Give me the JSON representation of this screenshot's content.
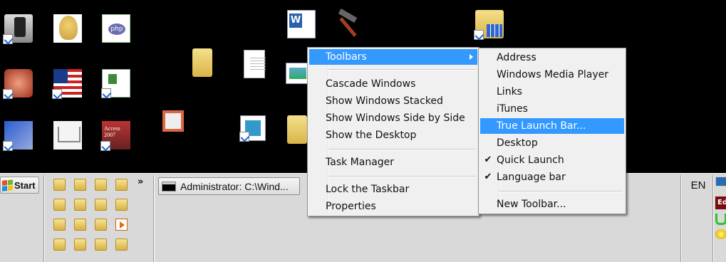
{
  "desktop": {
    "icons": [
      {
        "name": "device-sync-shortcut-icon"
      },
      {
        "name": "head-avatar-icon"
      },
      {
        "name": "php-network-icon"
      },
      {
        "name": "game-shortcut-icon"
      },
      {
        "name": "uk-flag-shortcut-icon"
      },
      {
        "name": "network-shortcut-icon"
      },
      {
        "name": "windows-update-shortcut-icon"
      },
      {
        "name": "shopping-cart-icon"
      },
      {
        "name": "access-2007-shortcut-icon"
      },
      {
        "name": "word-document-icon"
      },
      {
        "name": "hammer-icon"
      },
      {
        "name": "control-panel-folder-icon"
      },
      {
        "name": "folder-icon"
      },
      {
        "name": "text-document-icon"
      },
      {
        "name": "picture-shortcut-icon"
      },
      {
        "name": "signpost-icon"
      },
      {
        "name": "media-shortcut-icon"
      },
      {
        "name": "folder-icon"
      }
    ]
  },
  "taskbar": {
    "start_label": "Start",
    "quick_launch_chevron": "»",
    "task_button_label": "Administrator: C:\\Wind...",
    "language": "EN",
    "tray_badge": "Ed"
  },
  "context_menu": {
    "items": [
      {
        "label": "Toolbars",
        "highlighted": true,
        "has_submenu": true
      },
      {
        "label": "Cascade Windows"
      },
      {
        "label": "Show Windows Stacked"
      },
      {
        "label": "Show Windows Side by Side"
      },
      {
        "label": "Show the Desktop"
      },
      {
        "label": "Task Manager"
      },
      {
        "label": "Lock the Taskbar"
      },
      {
        "label": "Properties"
      }
    ]
  },
  "toolbars_submenu": {
    "items": [
      {
        "label": "Address"
      },
      {
        "label": "Windows Media Player"
      },
      {
        "label": "Links"
      },
      {
        "label": "iTunes"
      },
      {
        "label": "True Launch Bar...",
        "highlighted": true
      },
      {
        "label": "Desktop"
      },
      {
        "label": "Quick Launch",
        "checked": true
      },
      {
        "label": "Language bar",
        "checked": true
      },
      {
        "label": "New Toolbar..."
      }
    ],
    "check_glyph": "✔"
  },
  "colors": {
    "highlight": "#3399ff",
    "menu_bg": "#f0f0f0",
    "taskbar_bg": "#d9d9d9",
    "desktop_bg": "#000000"
  }
}
